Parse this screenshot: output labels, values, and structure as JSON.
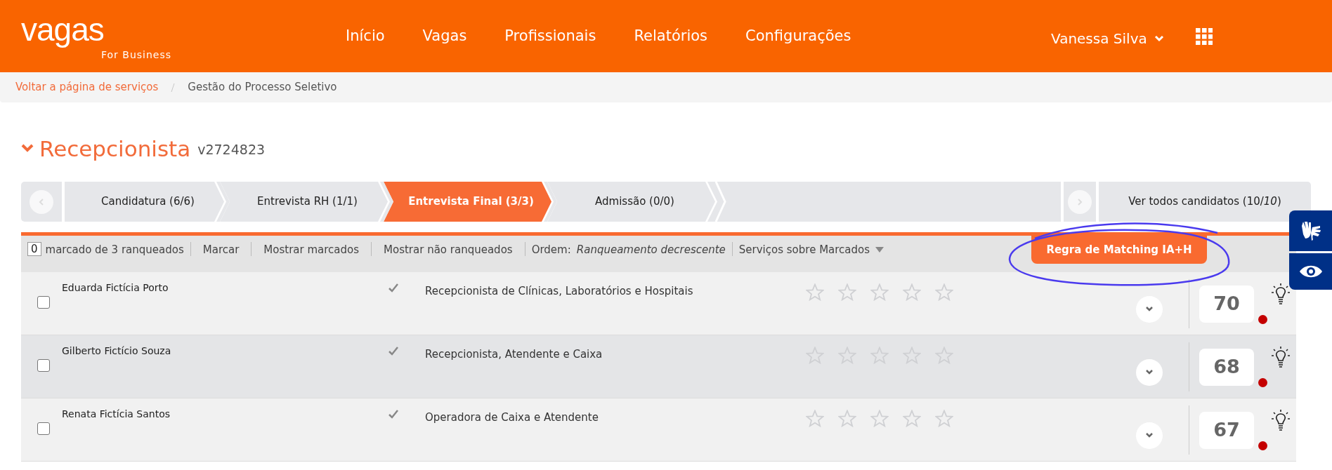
{
  "header": {
    "logo": "vagas",
    "logo_subtitle": "For Business",
    "nav": [
      "Início",
      "Vagas",
      "Profissionais",
      "Relatórios",
      "Configurações"
    ],
    "user": "Vanessa Silva"
  },
  "breadcrumb": [
    "Voltar a página de serviços",
    "Gestão do Processo Seletivo"
  ],
  "job": {
    "title": "Recepcionista",
    "code": "v2724823"
  },
  "tabs": [
    {
      "label": "Candidatura (6/6)",
      "selected": false
    },
    {
      "label": "Entrevista RH (1/1)",
      "selected": false
    },
    {
      "label": "Entrevista Final (3/3)",
      "selected": true
    },
    {
      "label": "Admissão (0/0)",
      "selected": false
    }
  ],
  "all_candidates": {
    "label": "Ver todos candidatos (10/",
    "total": "10",
    "close": ")"
  },
  "toolbar": {
    "marked_count": "0",
    "marked_text": "marcado de 3 ranqueados",
    "actions": [
      "Marcar",
      "Mostrar marcados",
      "Mostrar não ranqueados"
    ],
    "order_label": "Ordem:",
    "order_value": "Ranqueamento decrescente",
    "services": "Serviços sobre Marcados",
    "matching_button": "Regra de Matching IA+H"
  },
  "candidates": [
    {
      "name": "Eduarda Fictícia Porto",
      "role": "Recepcionista de Clínicas, Laboratórios e Hospitais",
      "checked": false,
      "highlighted": false,
      "stars": 0,
      "score": "70"
    },
    {
      "name": "Gilberto Fictício Souza",
      "role": "Recepcionista, Atendente e Caixa",
      "checked": false,
      "highlighted": true,
      "stars": 0,
      "score": "68"
    },
    {
      "name": "Renata Fictícia Santos",
      "role": "Operadora de Caixa e Atendente",
      "checked": false,
      "highlighted": false,
      "stars": 0,
      "score": "67"
    }
  ]
}
